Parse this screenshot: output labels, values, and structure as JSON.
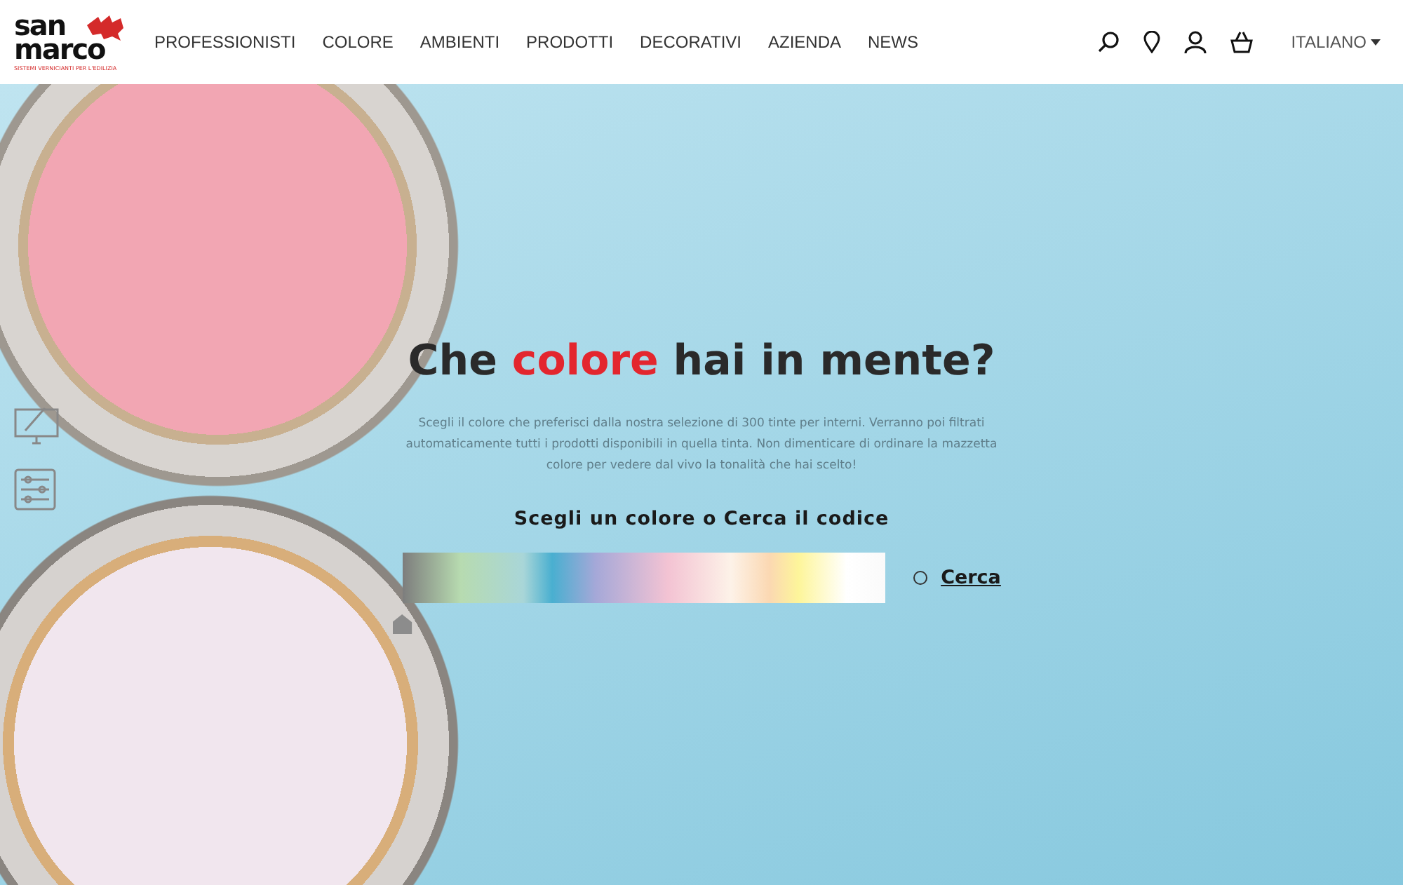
{
  "header": {
    "logo": {
      "line_1": "san",
      "line_2": "marco",
      "tagline": "SISTEMI VERNICIANTI PER L'EDILIZIA"
    },
    "nav": [
      {
        "label": "PROFESSIONISTI"
      },
      {
        "label": "COLORE"
      },
      {
        "label": "AMBIENTI"
      },
      {
        "label": "PRODOTTI"
      },
      {
        "label": "DECORATIVI"
      },
      {
        "label": "AZIENDA"
      },
      {
        "label": "NEWS"
      }
    ],
    "language": "ITALIANO"
  },
  "hero": {
    "title_parts": [
      {
        "text": "Che ",
        "accent": false
      },
      {
        "text": "colore",
        "accent": true
      },
      {
        "text": " hai in mente?",
        "accent": false
      }
    ],
    "description": "Scegli il colore che preferisci dalla nostra selezione di 300 tinte per interni. Verranno poi filtrati automaticamente tutti i prodotti disponibili in quella tinta. Non dimenticare di ordinare la mazzetta colore per vedere dal vivo la tonalità che hai scelto!",
    "subtitle": "Scegli un colore o Cerca il codice",
    "picker": {
      "level": 0
    },
    "search_option": {
      "label": "Cerca",
      "selected": false
    }
  }
}
